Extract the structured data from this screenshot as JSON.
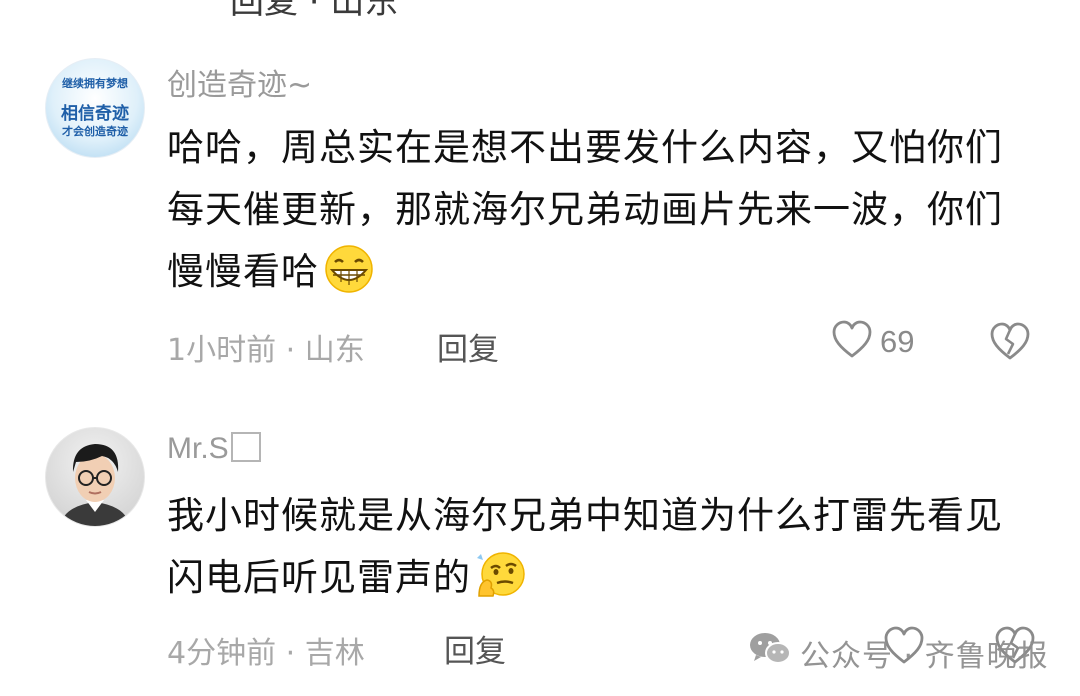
{
  "top_cut_text": "回复 · 山东",
  "comments": [
    {
      "username": "创造奇迹~",
      "avatar": {
        "badge_lines": [
          "继续拥有梦想",
          "相信奇迹",
          "才会创造奇迹"
        ]
      },
      "text": "哈哈，周总实在是想不出要发什么内容，又怕你们每天催更新，那就海尔兄弟动画片先来一波，你们慢慢看哈",
      "emoji": "grin-emoji",
      "meta": "1小时前 · 山东",
      "reply_label": "回复",
      "likes": "69"
    },
    {
      "username": "Mr.S",
      "text": "我小时候就是从海尔兄弟中知道为什么打雷先看见闪电后听见雷声的",
      "emoji": "thinking-emoji",
      "meta": "4分钟前 · 吉林",
      "reply_label": "回复",
      "likes": ""
    }
  ],
  "watermark": {
    "text": "公众号 · 齐鲁晚报"
  },
  "colors": {
    "text": "#111111",
    "meta": "#a8a8a8",
    "username": "#9a9a9a",
    "icon_stroke": "#8a8a8a"
  }
}
